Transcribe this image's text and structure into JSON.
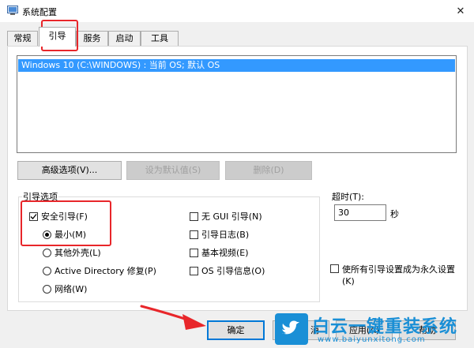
{
  "window": {
    "title": "系统配置",
    "close_glyph": "✕"
  },
  "tabs": [
    {
      "label": "常规"
    },
    {
      "label": "引导"
    },
    {
      "label": "服务"
    },
    {
      "label": "启动"
    },
    {
      "label": "工具"
    }
  ],
  "os_list": {
    "items": [
      "Windows 10 (C:\\WINDOWS) : 当前 OS; 默认 OS"
    ]
  },
  "os_buttons": {
    "advanced": "高级选项(V)...",
    "set_default": "设为默认值(S)",
    "delete": "删除(D)"
  },
  "boot_options": {
    "group_label": "引导选项",
    "safe_boot": {
      "label": "安全引导(F)",
      "checked": true
    },
    "minimal": {
      "label": "最小(M)",
      "selected": true
    },
    "alternate_shell": {
      "label": "其他外壳(L)",
      "selected": false
    },
    "ad_repair": {
      "label": "Active Directory 修复(P)",
      "selected": false
    },
    "network": {
      "label": "网络(W)",
      "selected": false
    },
    "no_gui": {
      "label": "无 GUI 引导(N)",
      "checked": false
    },
    "boot_log": {
      "label": "引导日志(B)",
      "checked": false
    },
    "base_video": {
      "label": "基本视频(E)",
      "checked": false
    },
    "os_boot_info": {
      "label": "OS 引导信息(O)",
      "checked": false
    }
  },
  "timeout": {
    "label": "超时(T):",
    "value": "30",
    "unit": "秒"
  },
  "permanent": {
    "label_line1": "使所有引导设置成为永久设置",
    "label_line2": "(K)",
    "checked": false
  },
  "footer": {
    "ok": "确定",
    "cancel_partial": "消",
    "apply": "应用(A)",
    "help_partial": "帮助"
  },
  "watermark": {
    "brand": "白云一键重装系统",
    "url": "www.baiyunxitong.com"
  },
  "colors": {
    "selection": "#3399ff",
    "annotation_red": "#e8262a",
    "watermark_blue": "#1a8fd6"
  }
}
